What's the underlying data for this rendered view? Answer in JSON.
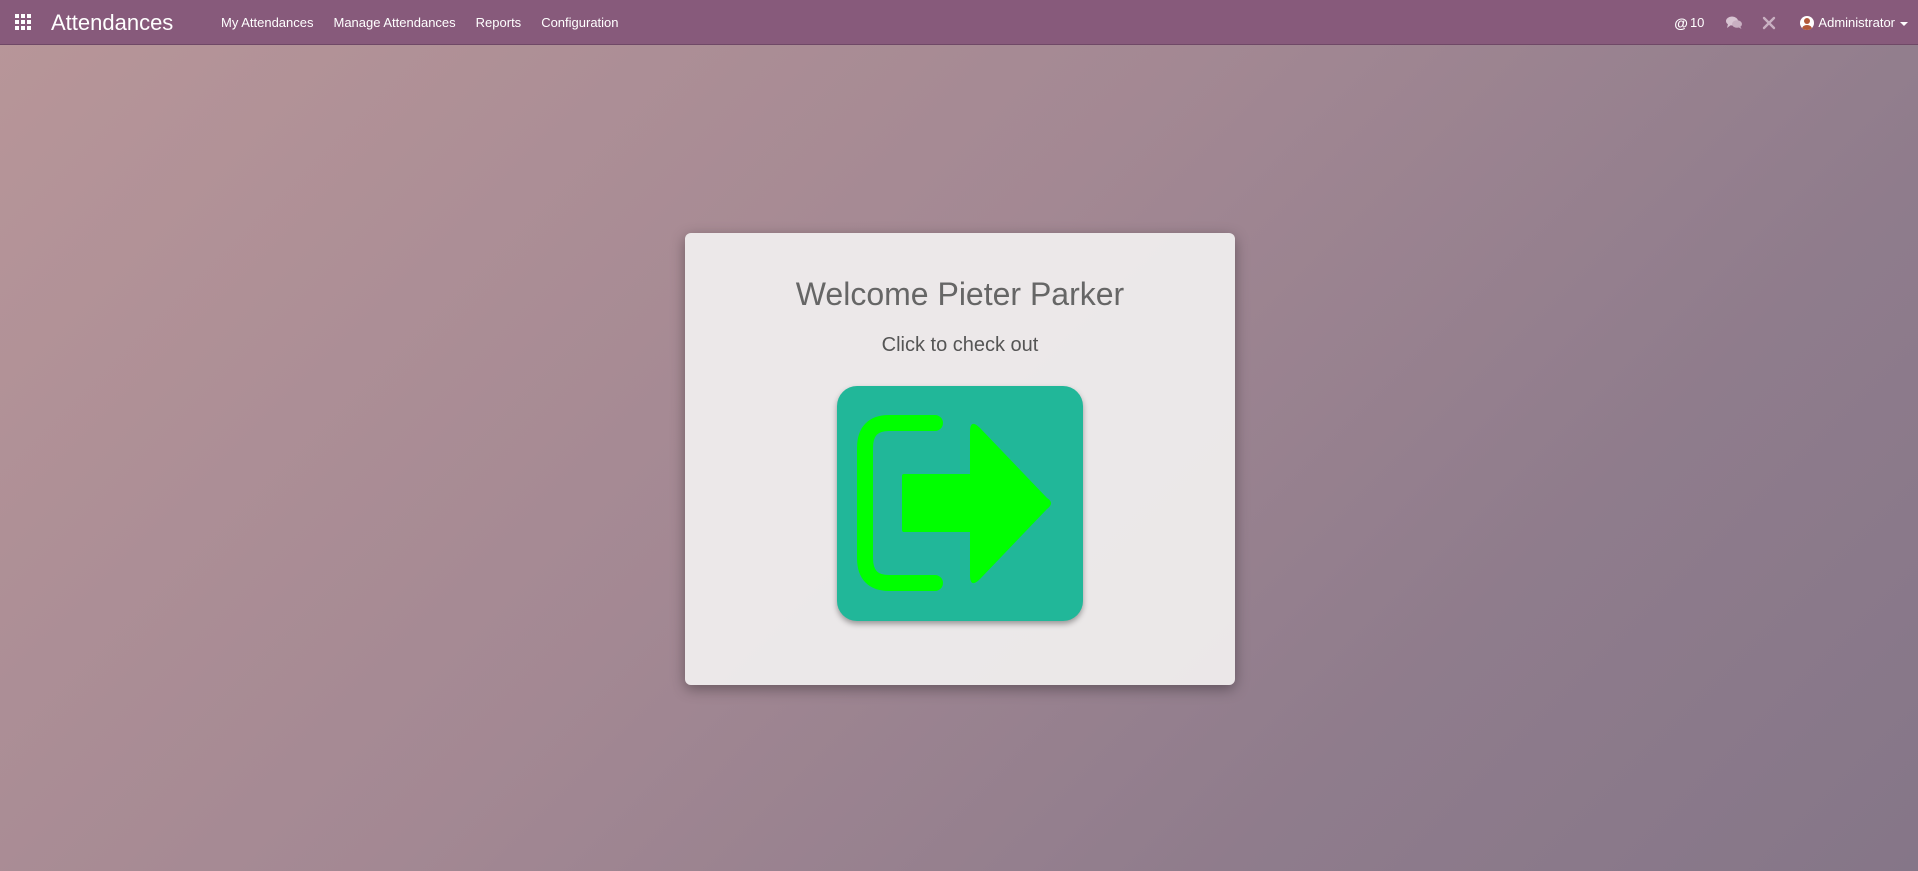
{
  "navbar": {
    "apps_icon": "grid-apps-icon",
    "app_title": "Attendances",
    "menu": [
      {
        "label": "My Attendances"
      },
      {
        "label": "Manage Attendances"
      },
      {
        "label": "Reports"
      },
      {
        "label": "Configuration"
      }
    ],
    "systray": {
      "mentions_count": "10",
      "mentions_icon": "at-icon",
      "messages_icon": "chat-bubbles-icon",
      "debug_icon": "bug-tools-icon",
      "user_name": "Administrator"
    }
  },
  "card": {
    "welcome": "Welcome Pieter Parker",
    "instruction": "Click to check out",
    "button_icon": "sign-out-icon"
  },
  "colors": {
    "navbar": "#875a7b",
    "button_bg": "#21b799",
    "icon_green": "#00ff00",
    "text_gray": "#666666"
  }
}
